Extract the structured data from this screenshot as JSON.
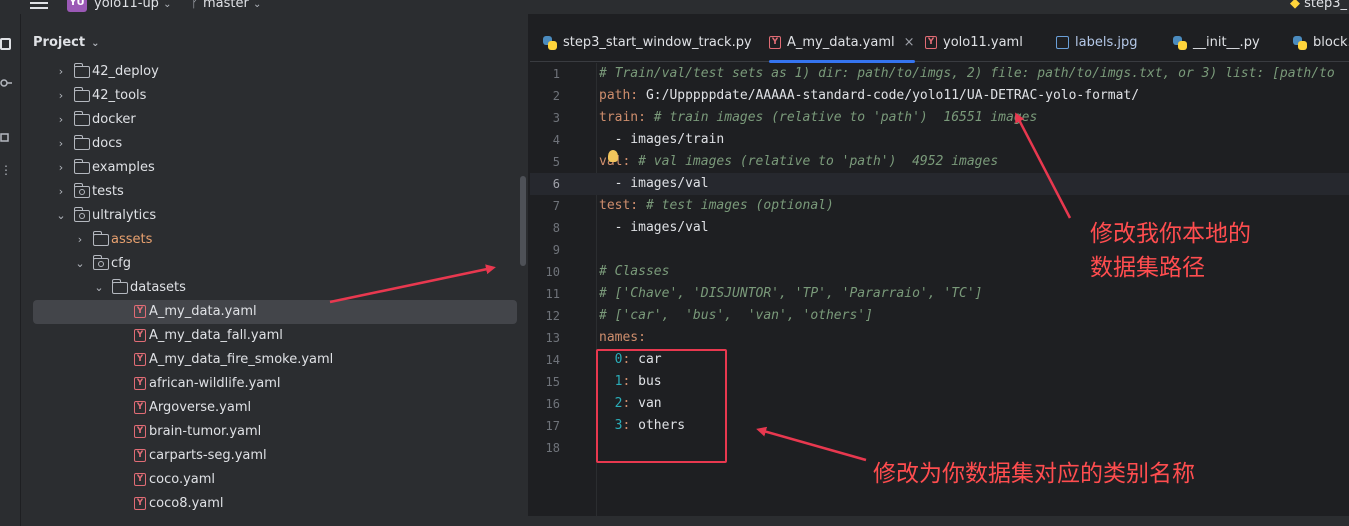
{
  "topbar": {
    "project_badge": "YU",
    "project_name": "yolo11-up",
    "branch": "master",
    "right_title": "step3_"
  },
  "project_panel": {
    "title": "Project",
    "tree": [
      {
        "label": "42_deploy",
        "kind": "folder"
      },
      {
        "label": "42_tools",
        "kind": "folder"
      },
      {
        "label": "docker",
        "kind": "folder"
      },
      {
        "label": "docs",
        "kind": "folder"
      },
      {
        "label": "examples",
        "kind": "folder"
      },
      {
        "label": "tests",
        "kind": "package"
      },
      {
        "label": "ultralytics",
        "kind": "package"
      },
      {
        "label": "assets",
        "kind": "folder"
      },
      {
        "label": "cfg",
        "kind": "package"
      },
      {
        "label": "datasets",
        "kind": "folder"
      },
      {
        "label": "A_my_data.yaml",
        "kind": "yaml"
      },
      {
        "label": "A_my_data_fall.yaml",
        "kind": "yaml"
      },
      {
        "label": "A_my_data_fire_smoke.yaml",
        "kind": "yaml"
      },
      {
        "label": "african-wildlife.yaml",
        "kind": "yaml"
      },
      {
        "label": "Argoverse.yaml",
        "kind": "yaml"
      },
      {
        "label": "brain-tumor.yaml",
        "kind": "yaml"
      },
      {
        "label": "carparts-seg.yaml",
        "kind": "yaml"
      },
      {
        "label": "coco.yaml",
        "kind": "yaml"
      },
      {
        "label": "coco8.yaml",
        "kind": "yaml"
      }
    ]
  },
  "tabs": [
    {
      "label": "step3_start_window_track.py",
      "icon": "python-icon"
    },
    {
      "label": "A_my_data.yaml",
      "icon": "yaml-icon",
      "active": true
    },
    {
      "label": "yolo11.yaml",
      "icon": "yaml-icon"
    },
    {
      "label": "labels.jpg",
      "icon": "image-icon"
    },
    {
      "label": "__init__.py",
      "icon": "python-icon"
    },
    {
      "label": "block.py",
      "icon": "python-icon"
    }
  ],
  "editor": {
    "current_line": 6,
    "lines": [
      "# Train/val/test sets as 1) dir: path/to/imgs, 2) file: path/to/imgs.txt, or 3) list: [path/to",
      "path: G:/Upppppdate/AAAAA-standard-code/yolo11/UA-DETRAC-yolo-format/",
      "train: # train images (relative to 'path')  16551 images",
      "  - images/train",
      "val: # val images (relative to 'path')  4952 images",
      "  - images/val",
      "test: # test images (optional)",
      "  - images/val",
      "",
      "# Classes",
      "# ['Chave', 'DISJUNTOR', 'TP', 'Pararraio', 'TC']",
      "# ['car',  'bus',  'van', 'others']",
      "names:",
      "  0: car",
      "  1: bus",
      "  2: van",
      "  3: others",
      ""
    ]
  },
  "annotations": {
    "path_note_line1": "修改我你本地的",
    "path_note_line2": "数据集路径",
    "names_note": "修改为你数据集对应的类别名称",
    "color": "#ff4d4f"
  }
}
